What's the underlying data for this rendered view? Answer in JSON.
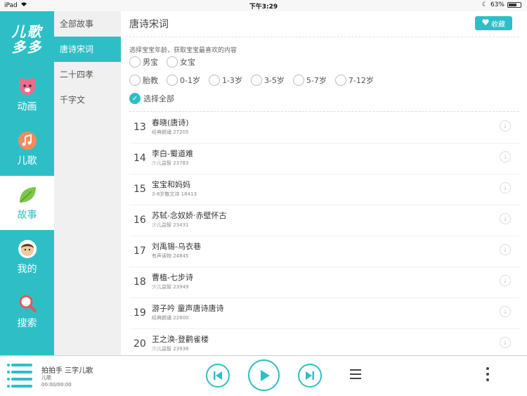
{
  "status_bar": {
    "device": "iPad",
    "time": "下午3:29",
    "battery": "63%",
    "battery_level": 0.63
  },
  "nav": {
    "logo": "儿歌多多",
    "items": [
      {
        "label": "动画",
        "icon": "bear-icon"
      },
      {
        "label": "儿歌",
        "icon": "music-note-icon"
      },
      {
        "label": "故事",
        "icon": "leaf-icon",
        "active": true
      },
      {
        "label": "我的",
        "icon": "child-avatar-icon"
      },
      {
        "label": "搜索",
        "icon": "search-icon"
      }
    ]
  },
  "categories": [
    {
      "label": "全部故事"
    },
    {
      "label": "唐诗宋词",
      "active": true
    },
    {
      "label": "二十四孝"
    },
    {
      "label": "千字文"
    }
  ],
  "main": {
    "title": "唐诗宋词",
    "favorite_label": "收藏",
    "hint": "选择宝宝年龄，获取宝宝最喜欢的内容",
    "gender_options": [
      "男宝",
      "女宝"
    ],
    "age_options": [
      "胎教",
      "0-1岁",
      "1-3岁",
      "3-5岁",
      "5-7岁",
      "7-12岁"
    ],
    "select_all": "选择全部"
  },
  "list": [
    {
      "num": "13",
      "title": "春晓(唐诗)",
      "sub": "经典朗诵 27205"
    },
    {
      "num": "14",
      "title": "李白-蜀道难",
      "sub": "少儿益智 23783"
    },
    {
      "num": "15",
      "title": "宝宝和妈妈",
      "sub": "3-8岁散文诗 18413"
    },
    {
      "num": "16",
      "title": "苏轼-念奴娇·赤壁怀古",
      "sub": "少儿益智 23431"
    },
    {
      "num": "17",
      "title": "刘禹锡-乌衣巷",
      "sub": "有声读物 24845"
    },
    {
      "num": "18",
      "title": "曹植-七步诗",
      "sub": "少儿益智 23949"
    },
    {
      "num": "19",
      "title": "游子吟  童声唐诗唐诗",
      "sub": "经典朗诵 22800"
    },
    {
      "num": "20",
      "title": "王之涣-登鹳雀楼",
      "sub": "少儿益智 23938"
    }
  ],
  "player": {
    "title": "拍拍手  三字儿歌",
    "artist": "儿歌",
    "time": "00:00/00:00"
  },
  "colors": {
    "accent": "#2ebfc6",
    "nav_bg": "#2ebfc6",
    "category_bg": "#f0f0f0"
  }
}
